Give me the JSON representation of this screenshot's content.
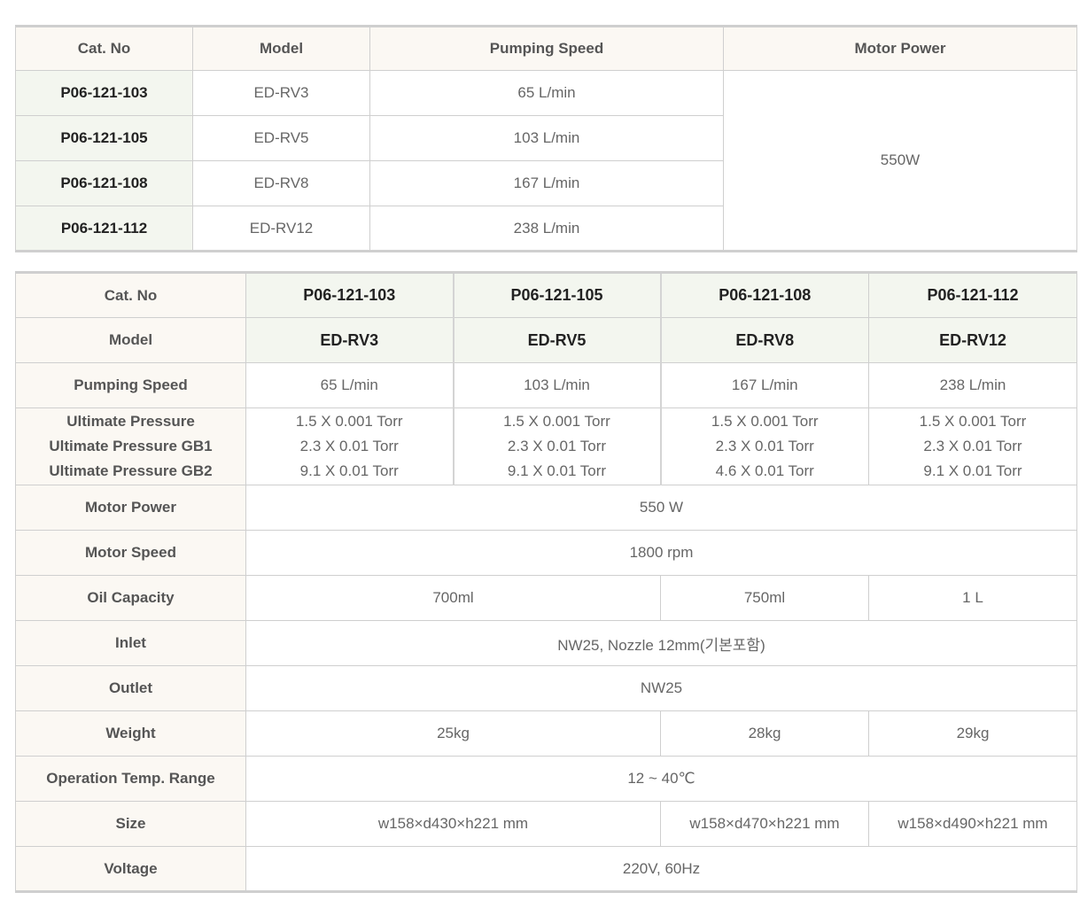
{
  "table1": {
    "headers": [
      "Cat. No",
      "Model",
      "Pumping Speed",
      "Motor Power"
    ],
    "rows": [
      {
        "cat": "P06-121-103",
        "model": "ED-RV3",
        "speed": "65 L/min"
      },
      {
        "cat": "P06-121-105",
        "model": "ED-RV5",
        "speed": "103 L/min"
      },
      {
        "cat": "P06-121-108",
        "model": "ED-RV8",
        "speed": "167 L/min"
      },
      {
        "cat": "P06-121-112",
        "model": "ED-RV12",
        "speed": "238 L/min"
      }
    ],
    "motor_power": "550W"
  },
  "table2": {
    "cat_label": "Cat. No",
    "cats": [
      "P06-121-103",
      "P06-121-105",
      "P06-121-108",
      "P06-121-112"
    ],
    "model_label": "Model",
    "models": [
      "ED-RV3",
      "ED-RV5",
      "ED-RV8",
      "ED-RV12"
    ],
    "speed_label": "Pumping Speed",
    "speeds": [
      "65 L/min",
      "103 L/min",
      "167 L/min",
      "238 L/min"
    ],
    "pressure_labels": [
      "Ultimate Pressure",
      "Ultimate Pressure GB1",
      "Ultimate Pressure GB2"
    ],
    "pressures": [
      [
        "1.5 X 0.001 Torr",
        "2.3 X 0.01 Torr",
        "9.1 X 0.01 Torr"
      ],
      [
        "1.5 X 0.001 Torr",
        "2.3 X 0.01 Torr",
        "9.1 X 0.01 Torr"
      ],
      [
        "1.5 X 0.001 Torr",
        "2.3 X 0.01 Torr",
        "4.6 X 0.01 Torr"
      ],
      [
        "1.5 X 0.001 Torr",
        "2.3 X 0.01 Torr",
        "9.1 X 0.01 Torr"
      ]
    ],
    "motor_power_label": "Motor Power",
    "motor_power": "550 W",
    "motor_speed_label": "Motor Speed",
    "motor_speed": "1800 rpm",
    "oil_label": "Oil Capacity",
    "oil": [
      "700ml",
      "750ml",
      "1 L"
    ],
    "inlet_label": "Inlet",
    "inlet": "NW25, Nozzle 12mm(기본포함)",
    "outlet_label": "Outlet",
    "outlet": "NW25",
    "weight_label": "Weight",
    "weight": [
      "25kg",
      "28kg",
      "29kg"
    ],
    "temp_label": "Operation Temp. Range",
    "temp": "12 ~ 40℃",
    "size_label": "Size",
    "size": [
      "w158×d430×h221 mm",
      "w158×d470×h221 mm",
      "w158×d490×h221 mm"
    ],
    "voltage_label": "Voltage",
    "voltage": "220V, 60Hz"
  }
}
